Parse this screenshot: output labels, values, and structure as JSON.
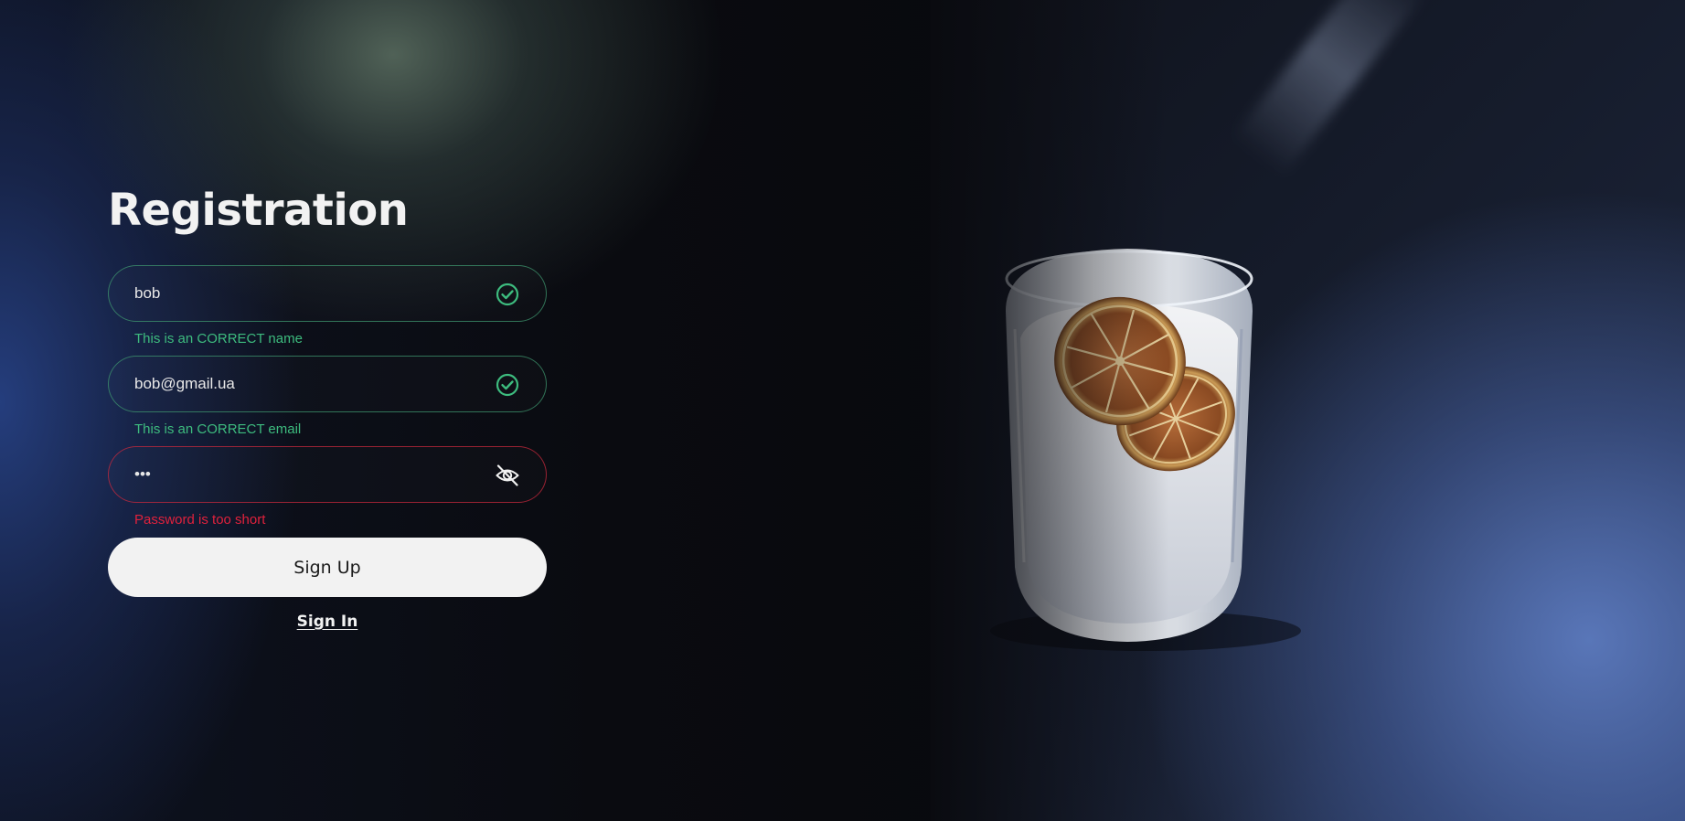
{
  "form": {
    "title": "Registration",
    "name_field": {
      "value": "bob",
      "hint": "This is an CORRECT name",
      "status": "valid",
      "icon": "check-circle-icon"
    },
    "email_field": {
      "value": "bob@gmail.ua",
      "hint": "This is an CORRECT email",
      "status": "valid",
      "icon": "check-circle-icon"
    },
    "password_field": {
      "value": "abc",
      "hint": "Password is too short",
      "status": "error",
      "icon": "eye-off-icon"
    },
    "signup_label": "Sign Up",
    "signin_label": "Sign In"
  },
  "colors": {
    "valid": "#3dbb7e",
    "error": "#e0213c",
    "button_bg": "#f2f2f2",
    "text": "#f2f2f2"
  }
}
